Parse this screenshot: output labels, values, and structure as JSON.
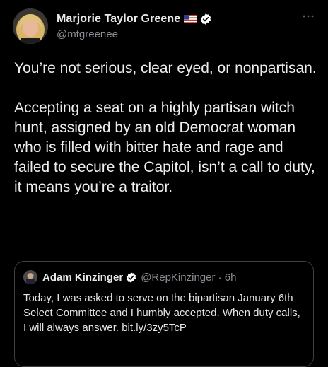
{
  "tweet": {
    "author": {
      "display_name": "Marjorie Taylor Greene",
      "handle": "@mtgreenee",
      "flag_icon": "us-flag-icon",
      "verified_icon": "verified-badge-icon"
    },
    "more_icon": "more-options-icon",
    "text_paragraph_1": "You’re not serious, clear eyed, or nonpartisan.",
    "text_paragraph_2": "Accepting a seat on a highly partisan witch hunt, assigned by an old Democrat woman who is filled with bitter hate and rage and failed to secure the Capitol, isn’t a call to duty, it means you’re a traitor."
  },
  "quoted_tweet": {
    "display_name": "Adam Kinzinger",
    "handle_and_time": "@RepKinzinger · 6h",
    "text": "Today, I was asked to serve on the bipartisan January 6th Select Committee and I humbly accepted. When duty calls, I will always answer. bit.ly/3zy5TcP"
  },
  "colors": {
    "background": "#000000",
    "text_primary": "#e7e9ea",
    "text_secondary": "#8b8f94",
    "verified_blue": "#ffffff",
    "border": "#3c3f43"
  }
}
